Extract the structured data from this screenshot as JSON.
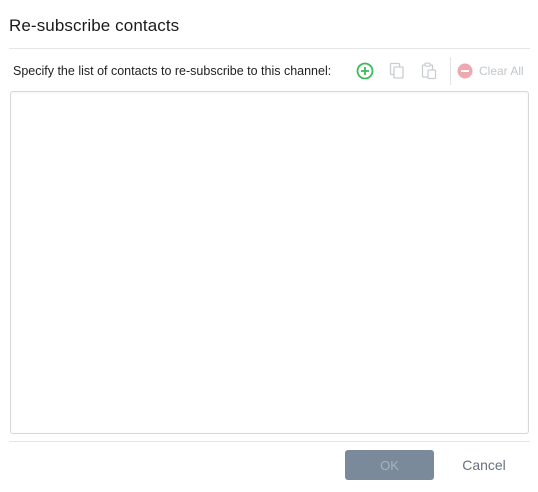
{
  "dialog": {
    "title": "Re-subscribe contacts",
    "instruction": "Specify the list of contacts to re-subscribe to this channel:"
  },
  "toolbar": {
    "add_icon": "add-circle-icon",
    "copy_icon": "copy-icon",
    "paste_icon": "paste-icon",
    "clear_icon": "minus-circle-icon",
    "clear_label": "Clear All",
    "colors": {
      "add": "#3dbb5c",
      "disabled": "#c9cdd1",
      "clear": "#f0a8b0"
    }
  },
  "contacts": {
    "value": ""
  },
  "footer": {
    "ok_label": "OK",
    "cancel_label": "Cancel",
    "colors": {
      "ok_bg": "#7a8a9a",
      "cancel_text": "#66727e"
    }
  }
}
